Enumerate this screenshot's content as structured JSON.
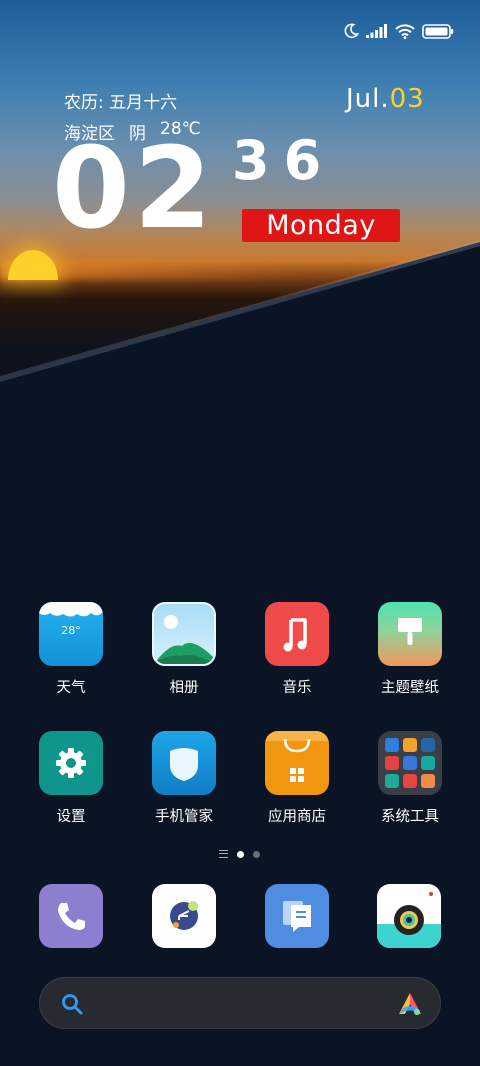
{
  "status_bar": {
    "icons": [
      "moon-icon",
      "signal-icon",
      "wifi-icon",
      "battery-icon"
    ]
  },
  "widget": {
    "lunar_date": "农历: 五月十六",
    "weather_location": "海淀区",
    "weather_condition": "阴",
    "weather_temp": "28℃",
    "date_month": "Jul.",
    "date_day": "03",
    "clock_hour": "02",
    "clock_minute": "36",
    "weekday": "Monday"
  },
  "apps_row1": [
    {
      "label": "天气",
      "icon": "weather-icon",
      "temp": "28°"
    },
    {
      "label": "相册",
      "icon": "gallery-icon"
    },
    {
      "label": "音乐",
      "icon": "music-icon"
    },
    {
      "label": "主题壁纸",
      "icon": "themes-icon"
    }
  ],
  "apps_row2": [
    {
      "label": "设置",
      "icon": "settings-icon"
    },
    {
      "label": "手机管家",
      "icon": "security-icon"
    },
    {
      "label": "应用商店",
      "icon": "app-store-icon"
    },
    {
      "label": "系统工具",
      "icon": "tools-folder-icon"
    }
  ],
  "page_indicator": {
    "pages": 2,
    "current": 1
  },
  "dock": [
    {
      "icon": "phone-icon"
    },
    {
      "icon": "messages-icon"
    },
    {
      "icon": "notes-icon"
    },
    {
      "icon": "camera-icon"
    }
  ],
  "search_bar": {
    "icons": [
      "search-icon",
      "assistant-icon"
    ]
  },
  "colors": {
    "weekday_bg": "#e01616",
    "date_day": "#ffd21f",
    "weather": "#1ea3e6",
    "music": "#f04a4a",
    "settings": "#0f958c",
    "security": "#1593d6",
    "store": "#f3960f",
    "phone": "#8d7fd0",
    "notes": "#4f8de0"
  }
}
